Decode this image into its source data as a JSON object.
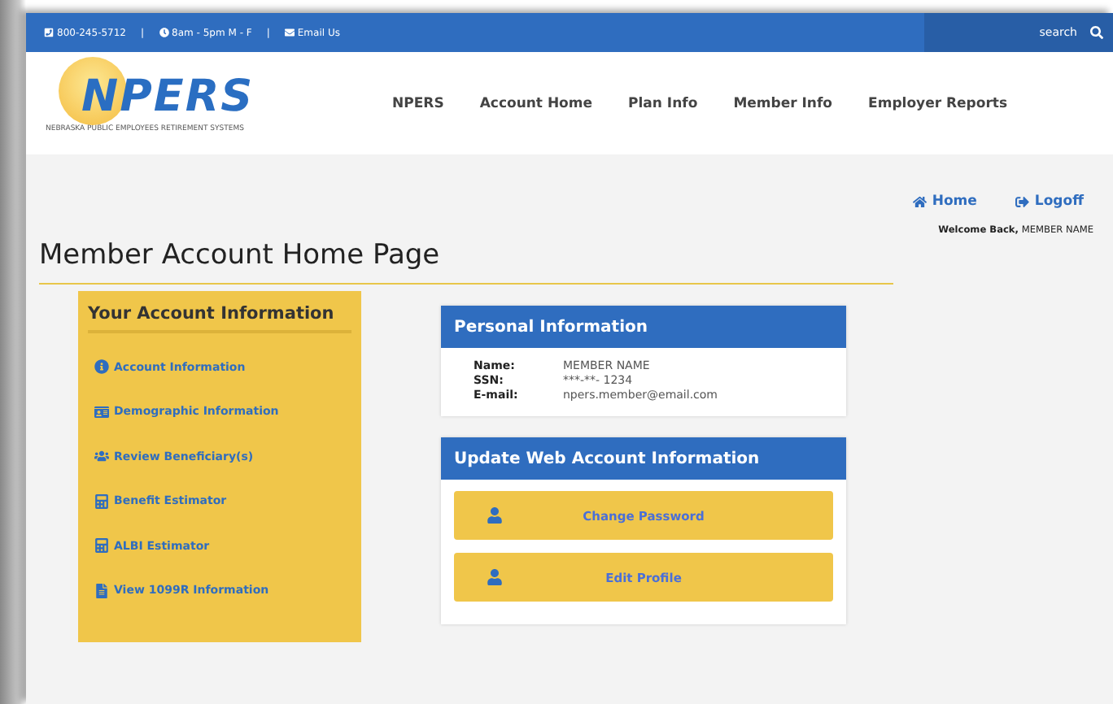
{
  "top_bar": {
    "phone": "800-245-5712",
    "hours": "8am - 5pm M - F",
    "separator": "|",
    "email": "Email Us",
    "search": {
      "placeholder": "search"
    }
  },
  "logo": {
    "name": "NPERS",
    "subtitle": "NEBRASKA PUBLIC EMPLOYEES RETIREMENT SYSTEMS"
  },
  "nav": [
    "NPERS",
    "Account Home",
    "Plan Info",
    "Member Info",
    "Employer Reports"
  ],
  "user_links": [
    "Home",
    "Logoff"
  ],
  "welcome": {
    "label": "Welcome Back,",
    "name": "MEMBER NAME"
  },
  "page_title": "Member Account Home Page",
  "account_panel": {
    "title": "Your Account Information",
    "items": [
      "Account Information",
      "Demographic Information",
      "Review Beneficiary(s)",
      "Benefit Estimator",
      "ALBI Estimator",
      "View 1099R Information"
    ]
  },
  "personal_info": {
    "title": "Personal Information",
    "fields": [
      {
        "label": "Name:",
        "value": "MEMBER NAME"
      },
      {
        "label": "SSN:",
        "value": "***-**- 1234"
      },
      {
        "label": "E-mail:",
        "value": "npers.member@email.com"
      }
    ]
  },
  "update_panel": {
    "title": "Update Web Account Information",
    "buttons": [
      "Change Password",
      "Edit Profile"
    ]
  }
}
